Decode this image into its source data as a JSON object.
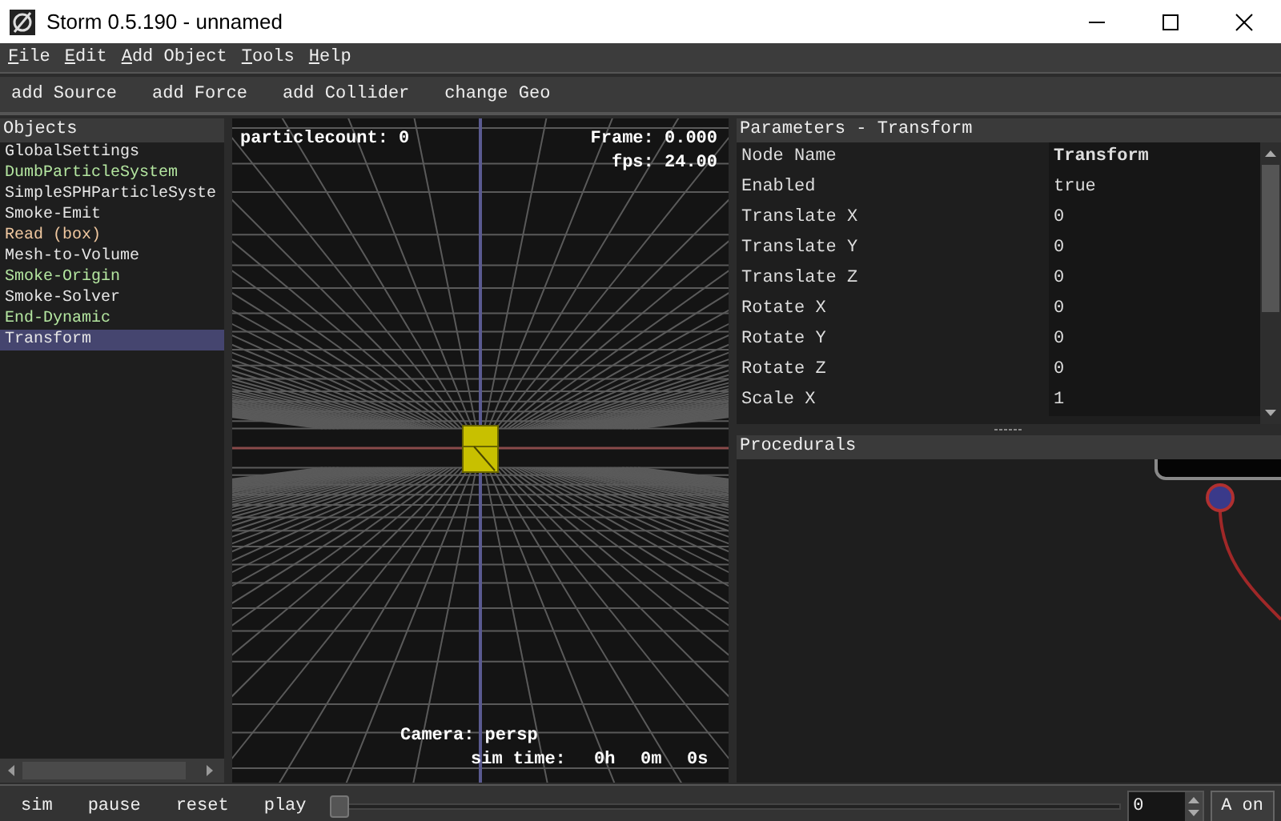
{
  "window": {
    "title": "Storm 0.5.190 - unnamed"
  },
  "menu": [
    "File",
    "Edit",
    "Add Object",
    "Tools",
    "Help"
  ],
  "toolbar": [
    "add Source",
    "add Force",
    "add Collider",
    "change Geo"
  ],
  "objects": {
    "title": "Objects",
    "items": [
      {
        "label": "GlobalSettings",
        "color": "#e6e6e6",
        "selected": false
      },
      {
        "label": "DumbParticleSystem",
        "color": "#b4e6a0",
        "selected": false
      },
      {
        "label": "SimpleSPHParticleSyste",
        "color": "#e6e6e6",
        "selected": false
      },
      {
        "label": "Smoke-Emit",
        "color": "#e6e6e6",
        "selected": false
      },
      {
        "label": "Read (box)",
        "color": "#f0c8a0",
        "selected": false
      },
      {
        "label": "Mesh-to-Volume",
        "color": "#e6e6e6",
        "selected": false
      },
      {
        "label": "Smoke-Origin",
        "color": "#b4e6a0",
        "selected": false
      },
      {
        "label": "Smoke-Solver",
        "color": "#e6e6e6",
        "selected": false
      },
      {
        "label": "End-Dynamic",
        "color": "#b4e6a0",
        "selected": false
      },
      {
        "label": "Transform",
        "selected": true
      }
    ]
  },
  "viewport": {
    "particle_count": "particlecount: 0",
    "frame": "Frame: 0.000",
    "fps": "fps: 24.00",
    "camera": "Camera: persp",
    "sim_time_label": "sim time:",
    "sim_time": [
      "0h",
      "0m",
      "0s"
    ]
  },
  "parameters": {
    "title": "Parameters - Transform",
    "rows": [
      {
        "name": "Node Name",
        "value": "Transform",
        "bold": true
      },
      {
        "name": "Enabled",
        "value": "true",
        "bold": false
      },
      {
        "name": "Translate X",
        "value": "0",
        "bold": false
      },
      {
        "name": "Translate Y",
        "value": "0",
        "bold": false
      },
      {
        "name": "Translate Z",
        "value": "0",
        "bold": false
      },
      {
        "name": "Rotate X",
        "value": "0",
        "bold": false
      },
      {
        "name": "Rotate Y",
        "value": "0",
        "bold": false
      },
      {
        "name": "Rotate Z",
        "value": "0",
        "bold": false
      },
      {
        "name": "Scale X",
        "value": "1",
        "bold": false
      }
    ]
  },
  "procedurals": {
    "title": "Procedurals"
  },
  "playback": {
    "buttons": [
      "sim",
      "pause",
      "reset",
      "play"
    ],
    "timeline": {
      "level": 0
    },
    "frame": "0",
    "toggle": "A on"
  }
}
